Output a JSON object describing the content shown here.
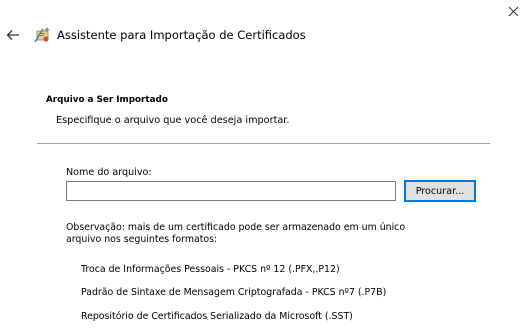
{
  "window": {
    "title": "Assistente para Importação de Certificados",
    "close_glyph": "✕",
    "back_glyph": "←"
  },
  "section": {
    "header": "Arquivo a Ser Importado",
    "description": "Especifique o arquivo que você deseja importar."
  },
  "file": {
    "label": "Nome do arquivo:",
    "value": "",
    "browse_label": "Procurar..."
  },
  "note": "Observação: mais de um certificado pode ser armazenado em um único arquivo nos seguintes formatos:",
  "formats": [
    "Troca de Informações Pessoais - PKCS nº 12 (.PFX,.P12)",
    "Padrão de Sintaxe de Mensagem Criptografada - PKCS nº7 (.P7B)",
    "Repositório de Certificados Serializado da Microsoft (.SST)"
  ],
  "colors": {
    "accent": "#0078d7",
    "divider": "#a0a0a0",
    "button_bg": "#e1e1e1"
  }
}
